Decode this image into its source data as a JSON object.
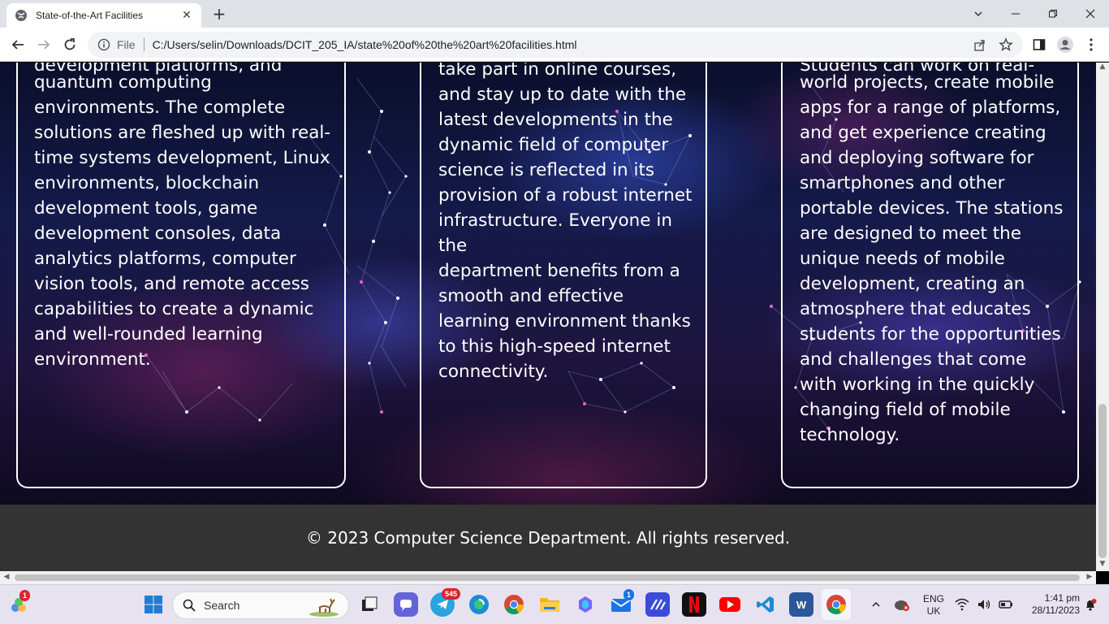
{
  "browser": {
    "tab_title": "State-of-the-Art Facilities",
    "scheme_label": "File",
    "url": "C:/Users/selin/Downloads/DCIT_205_IA/state%20of%20the%20art%20facilities.html"
  },
  "cards": [
    {
      "text_top": "development platforms, and",
      "text": "quantum computing\nenvironments. The complete\nsolutions are fleshed up with real-\ntime systems development, Linux\nenvironments, blockchain\ndevelopment tools, game\ndevelopment consoles, data\nanalytics platforms, computer\nvision tools, and remote access\ncapabilities to create a dynamic\nand well-rounded learning\nenvironment."
    },
    {
      "text": "take part in online courses,\nand stay up to date with the\nlatest developments in the\ndynamic field of computer\nscience is reflected in its\nprovision of a robust internet\ninfrastructure. Everyone in the\ndepartment benefits from a\nsmooth and effective\nlearning environment thanks\nto this high-speed internet\nconnectivity."
    },
    {
      "text_top": "Students can work on real-",
      "text": "world projects, create mobile\napps for a range of platforms,\nand get experience creating\nand deploying software for\nsmartphones and other\nportable devices. The stations\nare designed to meet the\nunique needs of mobile\ndevelopment, creating an\natmosphere that educates\nstudents for the opportunities\nand challenges that come\nwith working in the quickly\nchanging field of mobile\ntechnology."
    }
  ],
  "footer": {
    "text": "© 2023 Computer Science Department. All rights reserved."
  },
  "taskbar": {
    "search_placeholder": "Search",
    "widgets_badge": "1",
    "telegram_badge": "545",
    "mail_badge": "1",
    "language": "ENG",
    "region": "UK",
    "time": "1:41 pm",
    "date": "28/11/2023"
  },
  "colors": {
    "footer_bg": "#333333",
    "card_border": "#ffffff",
    "accent_chrome": "#1a73e8"
  }
}
